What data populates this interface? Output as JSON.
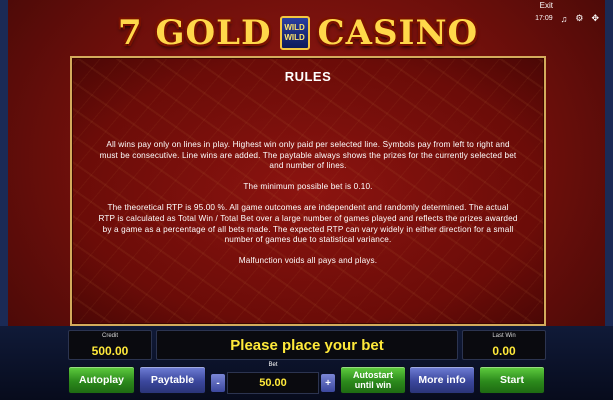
{
  "header": {
    "logo_left": "7 GOLD",
    "logo_badge_top": "WILD",
    "logo_badge_bottom": "WILD",
    "logo_right": "CASINO",
    "exit_label": "Exit",
    "clock": "17:09",
    "icons": [
      "music-note-icon",
      "settings-icon",
      "fullscreen-icon"
    ]
  },
  "rules": {
    "title": "RULES",
    "paragraphs": [
      "All wins pay only on lines in play. Highest win only paid per selected line. Symbols pay from left to right and must be consecutive. Line wins are added. The paytable always shows the prizes for the currently selected bet and number of lines.",
      "The minimum possible bet is 0.10.",
      "The theoretical RTP is 95.00 %. All game outcomes are independent and randomly determined. The actual RTP is calculated as Total Win / Total Bet over a large number of games played and reflects the prizes awarded by a game as a percentage of all bets made. The expected RTP can vary widely in either direction for a small number of games due to statistical variance.",
      "Malfunction voids all pays and plays."
    ]
  },
  "console": {
    "credit_label": "Credit",
    "credit_value": "500.00",
    "message": "Please place your bet",
    "last_win_label": "Last Win",
    "last_win_value": "0.00",
    "bet_label": "Bet",
    "bet_value": "50.00",
    "bet_minus": "-",
    "bet_plus": "+",
    "buttons": {
      "autoplay": "Autoplay",
      "paytable": "Paytable",
      "autostart_line1": "Autostart",
      "autostart_line2": "until win",
      "more_info": "More info",
      "start": "Start"
    }
  },
  "colors": {
    "background_red": "#8c1410",
    "panel_border_gold": "#d4ab5c",
    "value_yellow": "#ffe93a",
    "button_green": "#2c8a1c",
    "button_blue": "#3b479d"
  }
}
